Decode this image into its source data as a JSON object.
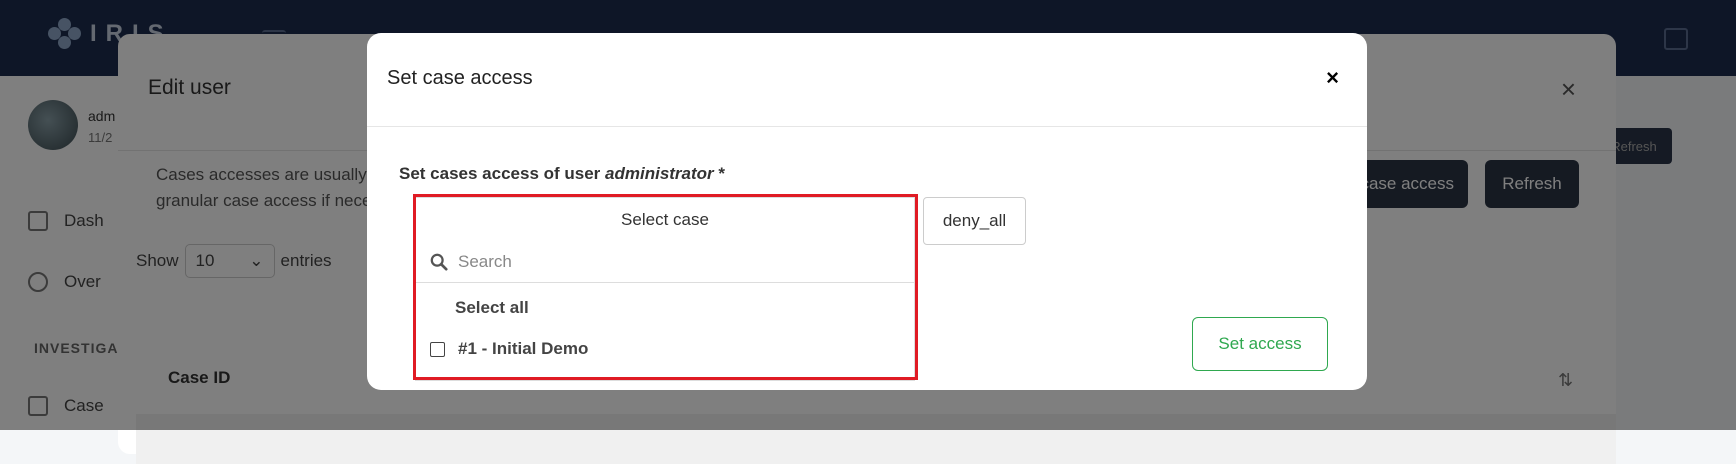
{
  "app": {
    "logo_text": "IRIS"
  },
  "sidebar": {
    "user_name": "adm",
    "user_date": "11/2",
    "items": [
      {
        "label": "Dash",
        "icon": "home-icon"
      },
      {
        "label": "Over",
        "icon": "user-icon"
      }
    ],
    "section_label": "INVESTIGA",
    "case_item": {
      "label": "Case",
      "icon": "briefcase-icon"
    }
  },
  "edit_user_modal": {
    "title": "Edit user",
    "info_line1": "Cases accesses are usually in",
    "info_line2": "granular case access if neces",
    "set_case_access_label": "case access",
    "refresh_label": "Refresh",
    "refresh_small_label": "Refresh",
    "show_label": "Show",
    "entries_value": "10",
    "entries_label": "entries",
    "column_case_id": "Case ID"
  },
  "set_case_access_modal": {
    "title": "Set case access",
    "close_symbol": "×",
    "field_label_prefix": "Set cases access of user ",
    "field_label_user": "administrator",
    "field_label_required": " *",
    "select_placeholder": "Select case",
    "search_placeholder": "Search",
    "select_all_label": "Select all",
    "options": [
      {
        "label": "#1 - Initial Demo",
        "checked": false
      }
    ],
    "access_value": "deny_all",
    "submit_label": "Set access"
  },
  "colors": {
    "topbar": "#1c2d4e",
    "highlight": "#e01b24",
    "success": "#2fa84f",
    "dark_button": "#2b3445"
  }
}
